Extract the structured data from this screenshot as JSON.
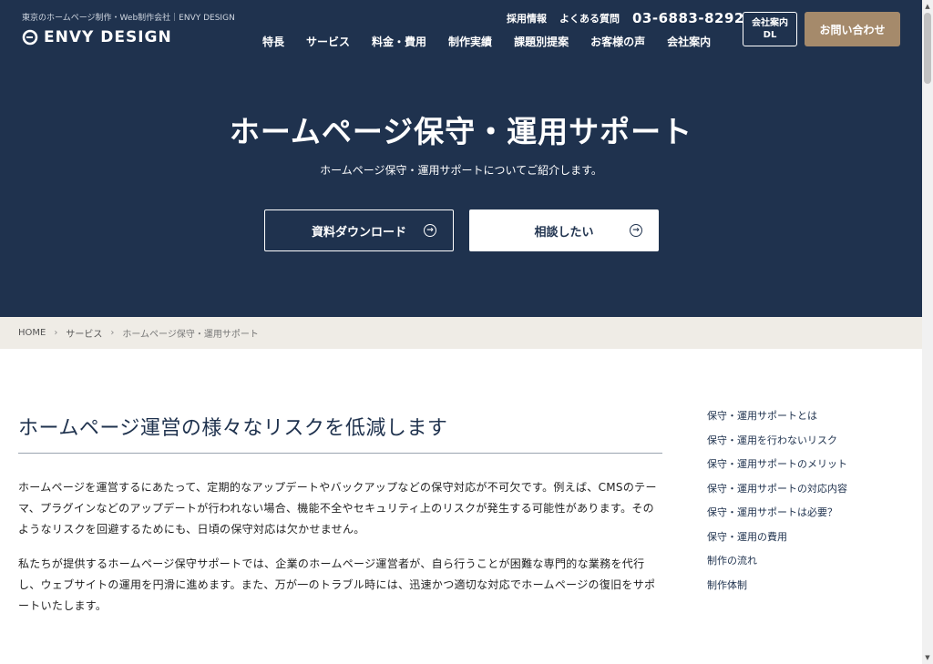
{
  "header": {
    "tagline": "東京のホームページ制作・Web制作会社｜ENVY DESIGN",
    "logo_text": "ENVY DESIGN",
    "util_links": [
      "採用情報",
      "よくある質問"
    ],
    "phone": "03-6883-8292",
    "main_nav": [
      "特長",
      "サービス",
      "料金・費用",
      "制作実績",
      "課題別提案",
      "お客様の声",
      "会社案内"
    ],
    "download_button": {
      "line1": "会社案内",
      "line2": "DL"
    },
    "contact_button": "お問い合わせ"
  },
  "hero": {
    "title": "ホームページ保守・運用サポート",
    "subtitle": "ホームページ保守・運用サポートについてご紹介します。",
    "cta_download": "資料ダウンロード",
    "cta_consult": "相談したい"
  },
  "breadcrumb": {
    "items": [
      "HOME",
      "サービス",
      "ホームページ保守・運用サポート"
    ]
  },
  "main": {
    "heading": "ホームページ運営の様々なリスクを低減します",
    "paragraphs": [
      "ホームページを運営するにあたって、定期的なアップデートやバックアップなどの保守対応が不可欠です。例えば、CMSのテーマ、プラグインなどのアップデートが行われない場合、機能不全やセキュリティ上のリスクが発生する可能性があります。そのようなリスクを回避するためにも、日頃の保守対応は欠かせません。",
      "私たちが提供するホームページ保守サポートでは、企業のホームページ運営者が、自ら行うことが困難な専門的な業務を代行し、ウェブサイトの運用を円滑に進めます。また、万が一のトラブル時には、迅速かつ適切な対応でホームページの復旧をサポートいたします。"
    ]
  },
  "toc": {
    "items": [
      "保守・運用サポートとは",
      "保守・運用を行わないリスク",
      "保守・運用サポートのメリット",
      "保守・運用サポートの対応内容",
      "保守・運用サポートは必要？",
      "保守・運用の費用",
      "制作の流れ",
      "制作体制"
    ]
  },
  "colors": {
    "navy": "#1f324e",
    "accent_brown": "#a58a6b",
    "breadcrumb_bg": "#efece6"
  },
  "icons": {
    "logo": "envy-logo-icon",
    "arrow": "arrow-circle-right-icon",
    "chevron": "chevron-right-icon"
  }
}
